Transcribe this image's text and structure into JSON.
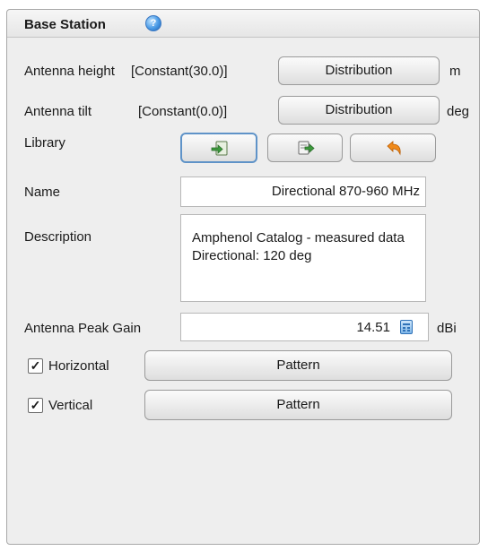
{
  "panel": {
    "title": "Base Station",
    "help_icon": "help-icon"
  },
  "antenna_height": {
    "label": "Antenna height",
    "value": "[Constant(30.0)]",
    "button": "Distribution",
    "unit": "m"
  },
  "antenna_tilt": {
    "label": "Antenna tilt",
    "value": "[Constant(0.0)]",
    "button": "Distribution",
    "unit": "deg"
  },
  "library": {
    "label": "Library",
    "buttons": [
      {
        "icon": "import-icon",
        "selected": true
      },
      {
        "icon": "export-icon",
        "selected": false
      },
      {
        "icon": "undo-icon",
        "selected": false
      }
    ]
  },
  "name": {
    "label": "Name",
    "value": "Directional 870-960 MHz"
  },
  "description": {
    "label": "Description",
    "value": "Amphenol Catalog - measured data Directional: 120 deg"
  },
  "peak_gain": {
    "label": "Antenna Peak Gain",
    "value": "14.51",
    "unit": "dBi",
    "icon": "calculator-icon"
  },
  "horizontal": {
    "label": "Horizontal",
    "checked": true,
    "check_glyph": "✓",
    "button": "Pattern"
  },
  "vertical": {
    "label": "Vertical",
    "checked": true,
    "check_glyph": "✓",
    "button": "Pattern"
  },
  "colors": {
    "panel_bg": "#eeeeee",
    "accent_blue": "#5f93c8",
    "import_green": "#3c9a3c",
    "undo_orange": "#f08a1a"
  }
}
